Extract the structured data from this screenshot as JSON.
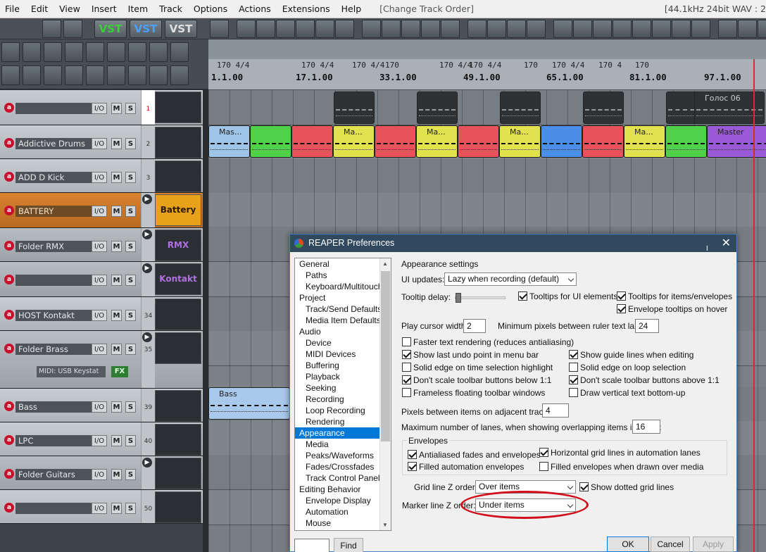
{
  "menu": [
    "File",
    "Edit",
    "View",
    "Insert",
    "Item",
    "Track",
    "Options",
    "Actions",
    "Extensions",
    "Help"
  ],
  "change_title": "[Change Track Order]",
  "status_right": "[44.1kHz 24bit WAV : 2",
  "vst": [
    "VST",
    "VST",
    "VST"
  ],
  "ruler": {
    "labels": [
      "1.1.00",
      "17.1.00",
      "33.1.00",
      "49.1.00",
      "65.1.00",
      "81.1.00",
      "97.1.00"
    ],
    "markers": [
      "170 4/4",
      "170 4/4",
      "170 4/4",
      "170",
      "170 4/4",
      "170 4/4",
      "170",
      "170 4/4",
      "170 4",
      "170"
    ]
  },
  "tracks": [
    {
      "name": "",
      "num": "1",
      "sel": true
    },
    {
      "name": "Addictive Drums",
      "num": "2"
    },
    {
      "name": "ADD D Kick",
      "num": "3"
    },
    {
      "name": "BATTERY",
      "num": "",
      "orange": true,
      "icon_text": "Battery"
    },
    {
      "name": "Folder RMX",
      "num": "",
      "folder": true,
      "icon_text": "RMX"
    },
    {
      "name": "",
      "num": "",
      "folder": true,
      "icon_text": "Kontakt"
    },
    {
      "name": "HOST Kontakt",
      "num": "34"
    },
    {
      "name": "Folder Brass",
      "num": "35",
      "folder": true,
      "midi": "MIDI: USB Keystat",
      "fx": "FX"
    },
    {
      "name": "Bass",
      "num": "39"
    },
    {
      "name": "LPC",
      "num": "40"
    },
    {
      "name": "Folder Guitars",
      "num": "",
      "folder": true
    },
    {
      "name": "",
      "num": "50"
    }
  ],
  "track_ctl": {
    "io": "I/O",
    "m": "M",
    "s": "S",
    "rec": "a"
  },
  "items": {
    "lane1_label": "Голос 06",
    "lane2": [
      "Mas...",
      "Ma...",
      "Ma...",
      "Ma...",
      "Ma...",
      "Master"
    ],
    "bass": "Bass"
  },
  "dialog": {
    "title": "REAPER Preferences",
    "tree": [
      {
        "t": "General",
        "c": false
      },
      {
        "t": "Paths",
        "c": true
      },
      {
        "t": "Keyboard/Multitouch",
        "c": true
      },
      {
        "t": "Project",
        "c": false
      },
      {
        "t": "Track/Send Defaults",
        "c": true
      },
      {
        "t": "Media Item Defaults",
        "c": true
      },
      {
        "t": "Audio",
        "c": false
      },
      {
        "t": "Device",
        "c": true
      },
      {
        "t": "MIDI Devices",
        "c": true
      },
      {
        "t": "Buffering",
        "c": true
      },
      {
        "t": "Playback",
        "c": true
      },
      {
        "t": "Seeking",
        "c": true
      },
      {
        "t": "Recording",
        "c": true
      },
      {
        "t": "Loop Recording",
        "c": true
      },
      {
        "t": "Rendering",
        "c": true
      },
      {
        "t": "Appearance",
        "c": false,
        "sel": true
      },
      {
        "t": "Media",
        "c": true
      },
      {
        "t": "Peaks/Waveforms",
        "c": true
      },
      {
        "t": "Fades/Crossfades",
        "c": true
      },
      {
        "t": "Track Control Panels",
        "c": true
      },
      {
        "t": "Editing Behavior",
        "c": false
      },
      {
        "t": "Envelope Display",
        "c": true
      },
      {
        "t": "Automation",
        "c": true
      },
      {
        "t": "Mouse",
        "c": true
      }
    ],
    "heading": "Appearance settings",
    "ui_updates_label": "UI updates:",
    "ui_updates_value": "Lazy when recording (default)",
    "tooltip_delay_label": "Tooltip delay:",
    "cb_tooltips_ui": "Tooltips for UI elements",
    "cb_tooltips_items": "Tooltips for items/envelopes",
    "cb_env_tooltips": "Envelope tooltips on hover",
    "play_cursor_label": "Play cursor width:",
    "play_cursor_value": "2",
    "min_pixels_label": "Minimum pixels between ruler text labels:",
    "min_pixels_value": "24",
    "cb_faster_text": "Faster text rendering (reduces antialiasing)",
    "cb_undo": "Show last undo point in menu bar",
    "cb_guide": "Show guide lines when editing",
    "cb_solid_time": "Solid edge on time selection highlight",
    "cb_solid_loop": "Solid edge on loop selection",
    "cb_dont_below": "Don't scale toolbar buttons below 1:1",
    "cb_dont_above": "Don't scale toolbar buttons above 1:1",
    "cb_frameless": "Frameless floating toolbar windows",
    "cb_vertical": "Draw vertical text bottom-up",
    "pixels_items_label": "Pixels between items on adjacent tracks:",
    "pixels_items_value": "4",
    "max_lanes_label": "Maximum number of lanes, when showing overlapping items in lanes:",
    "max_lanes_value": "16",
    "envelopes_group": "Envelopes",
    "cb_antialiased": "Antialiased fades and envelopes",
    "cb_horiz_grid": "Horizontal grid lines in automation lanes",
    "cb_filled_auto": "Filled automation envelopes",
    "cb_filled_over": "Filled envelopes when drawn over media",
    "grid_z_label": "Grid line Z order:",
    "grid_z_value": "Over items",
    "cb_dotted": "Show dotted grid lines",
    "marker_z_label": "Marker line Z order:",
    "marker_z_value": "Under items",
    "find_value": "",
    "find_btn": "Find",
    "ok": "OK",
    "cancel": "Cancel",
    "apply": "Apply"
  }
}
